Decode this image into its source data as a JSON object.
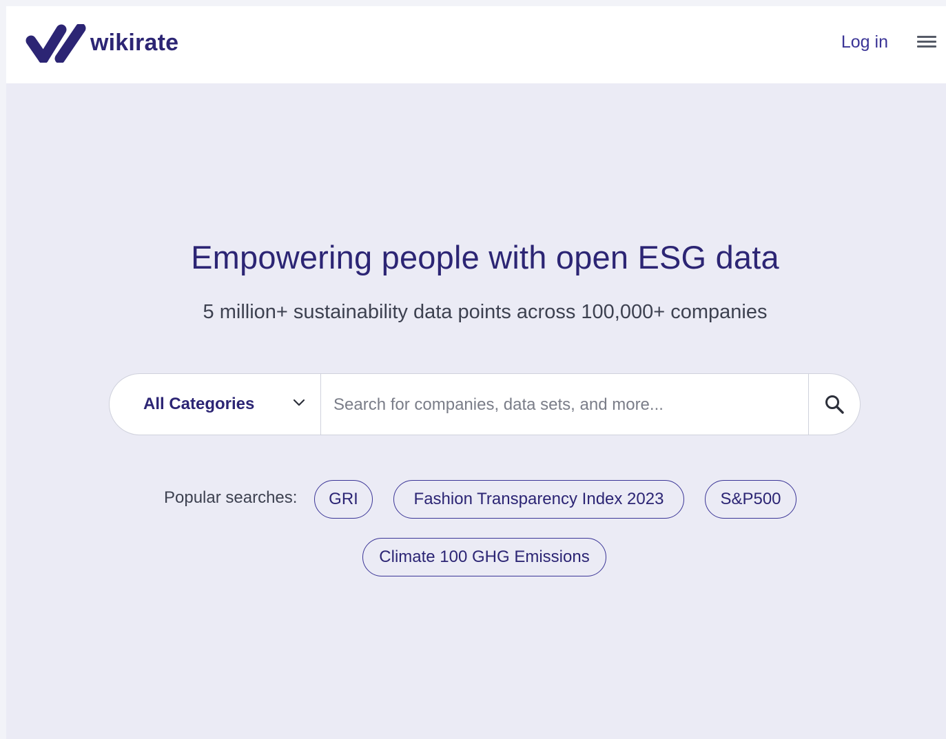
{
  "header": {
    "logo_text": "wikirate",
    "login_label": "Log in"
  },
  "hero": {
    "title": "Empowering people with open ESG data",
    "subtitle": "5 million+ sustainability data points across 100,000+ companies"
  },
  "search": {
    "category_selected": "All Categories",
    "placeholder": "Search for companies, data sets, and more..."
  },
  "popular": {
    "label": "Popular searches:",
    "items": [
      {
        "label": "GRI"
      },
      {
        "label": "Fashion Transparency Index 2023"
      },
      {
        "label": "S&P500"
      },
      {
        "label": "Climate 100 GHG Emissions"
      }
    ]
  },
  "colors": {
    "brand": "#2c2574",
    "accent": "#3a3496",
    "background": "#ebebf5"
  },
  "icons": [
    "wikirate-logo-icon",
    "hamburger-menu-icon",
    "chevron-down-icon",
    "search-icon"
  ]
}
